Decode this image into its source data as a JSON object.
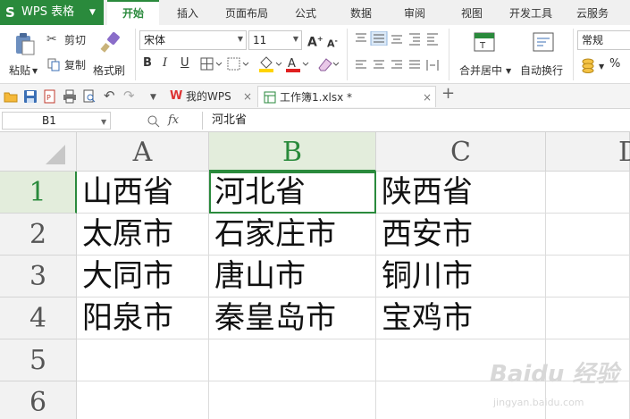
{
  "app": {
    "name": "WPS 表格",
    "brand_color": "#2a8a3c"
  },
  "menu_tabs": [
    "开始",
    "插入",
    "页面布局",
    "公式",
    "数据",
    "审阅",
    "视图",
    "开发工具",
    "云服务"
  ],
  "active_menu_tab": "开始",
  "ribbon": {
    "paste": "粘贴",
    "cut": "剪切",
    "copy": "复制",
    "format_painter": "格式刷",
    "font_name": "宋体",
    "font_size": "11",
    "bold": "B",
    "italic": "I",
    "underline": "U",
    "merge_center": "合并居中",
    "wrap_text": "自动换行",
    "number_format": "常规",
    "percent": "%"
  },
  "doc_tabs": [
    {
      "label": "我的WPS",
      "active": false
    },
    {
      "label": "工作簿1.xlsx *",
      "active": true
    }
  ],
  "formula_bar": {
    "name_box": "B1",
    "fx": "fx",
    "content": "河北省"
  },
  "sheet": {
    "columns": [
      "A",
      "B",
      "C",
      "D"
    ],
    "rows": [
      "1",
      "2",
      "3",
      "4",
      "5",
      "6"
    ],
    "selected_cell": "B1",
    "cells": [
      [
        "山西省",
        "河北省",
        "陕西省"
      ],
      [
        "太原市",
        "石家庄市",
        "西安市"
      ],
      [
        "大同市",
        "唐山市",
        "铜川市"
      ],
      [
        "阳泉市",
        "秦皇岛市",
        "宝鸡市"
      ]
    ]
  },
  "watermark": {
    "main": "Baidu 经验",
    "sub": "jingyan.baidu.com"
  }
}
